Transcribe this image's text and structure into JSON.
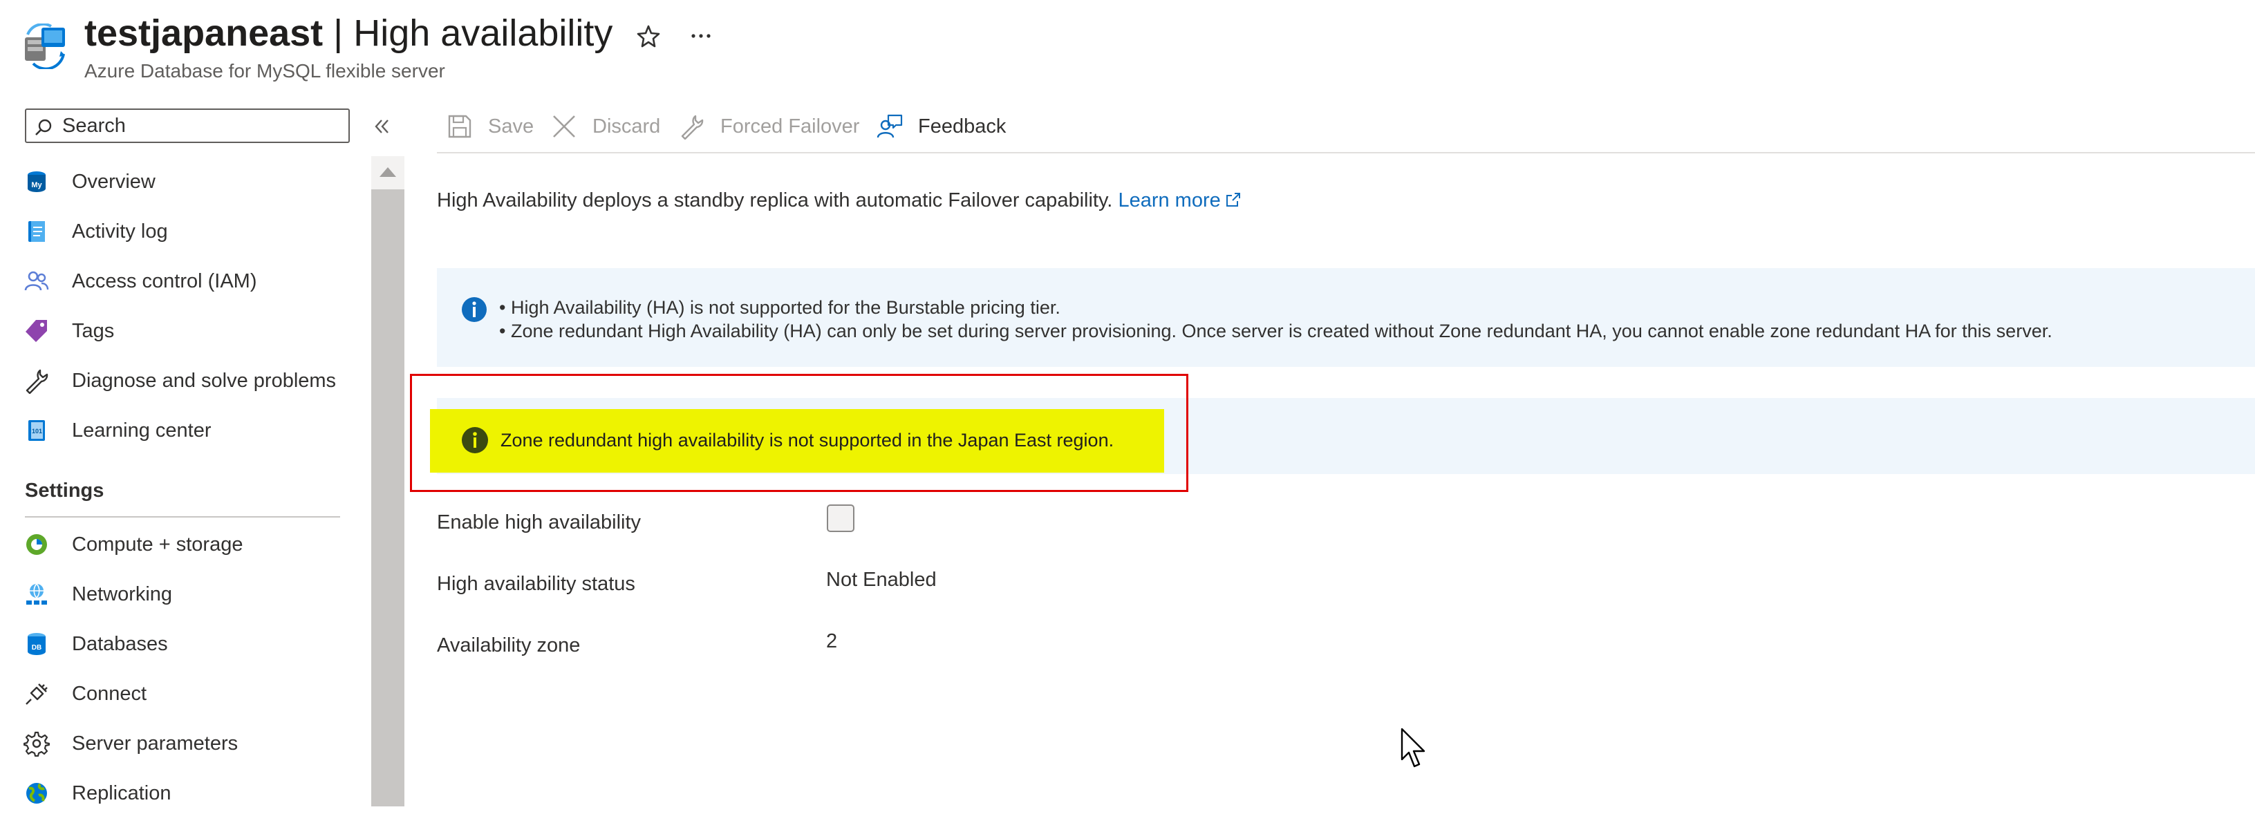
{
  "header": {
    "resource_name": "testjapaneast",
    "page_name": "High availability",
    "separator": " | ",
    "subtitle": "Azure Database for MySQL flexible server",
    "icon": "mysql-server-icon"
  },
  "search": {
    "placeholder": "Search"
  },
  "sidebar": {
    "items": [
      {
        "label": "Overview",
        "icon": "mysql-icon"
      },
      {
        "label": "Activity log",
        "icon": "activity-log-icon"
      },
      {
        "label": "Access control (IAM)",
        "icon": "people-icon"
      },
      {
        "label": "Tags",
        "icon": "tag-icon"
      },
      {
        "label": "Diagnose and solve problems",
        "icon": "wrench-icon"
      },
      {
        "label": "Learning center",
        "icon": "book-icon"
      }
    ],
    "settings_header": "Settings",
    "settings_items": [
      {
        "label": "Compute + storage",
        "icon": "compute-storage-icon"
      },
      {
        "label": "Networking",
        "icon": "networking-icon"
      },
      {
        "label": "Databases",
        "icon": "database-icon"
      },
      {
        "label": "Connect",
        "icon": "plug-icon"
      },
      {
        "label": "Server parameters",
        "icon": "gear-icon"
      },
      {
        "label": "Replication",
        "icon": "globe-icon"
      }
    ]
  },
  "toolbar": {
    "save": "Save",
    "discard": "Discard",
    "forced_failover": "Forced Failover",
    "feedback": "Feedback"
  },
  "content": {
    "description": "High Availability deploys a standby replica with automatic Failover capability.",
    "learn_more": "Learn more",
    "info_lines": [
      "• High Availability (HA) is not supported for the Burstable pricing tier.",
      "• Zone redundant High Availability (HA) can only be set during server provisioning. Once server is created without Zone redundant HA, you cannot enable zone redundant HA for this server."
    ],
    "region_notice": "Zone redundant high availability is not supported in the Japan East region."
  },
  "form": {
    "enable_ha_label": "Enable high availability",
    "enable_ha_checked": false,
    "ha_status_label": "High availability status",
    "ha_status_value": "Not Enabled",
    "zone_label": "Availability zone",
    "zone_value": "2"
  },
  "colors": {
    "accent": "#0f6cbd",
    "info_bg": "#eff6fc",
    "highlight": "#eef300",
    "annotation_frame": "#e00000"
  }
}
